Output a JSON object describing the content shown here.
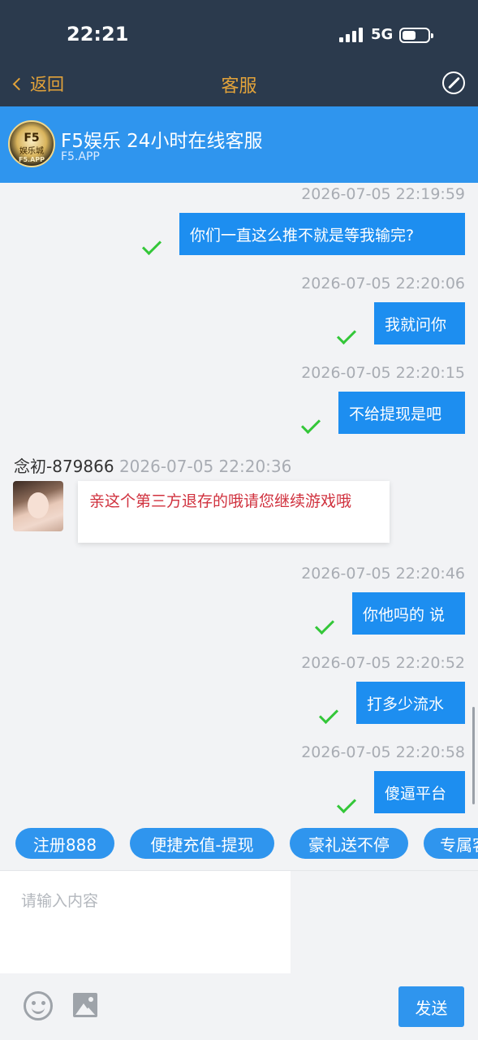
{
  "status_bar": {
    "time": "22:21",
    "network": "5G",
    "battery_icon": "battery-icon",
    "signal_icon": "signal-icon"
  },
  "nav": {
    "back_label": "返回",
    "title": "客服",
    "compass_icon": "compass-icon"
  },
  "service": {
    "name": "F5娱乐 24小时在线客服",
    "subtitle": "F5.APP",
    "logo": {
      "line1": "F5",
      "line2": "娱乐城",
      "line3": "F5.APP"
    }
  },
  "messages": [
    {
      "from": "me",
      "time": "2026-07-05 22:19:59",
      "text": "你们一直这么推不就是等我输完?"
    },
    {
      "from": "me",
      "time": "2026-07-05 22:20:06",
      "text": "我就问你"
    },
    {
      "from": "me",
      "time": "2026-07-05 22:20:15",
      "text": "不给提现是吧"
    },
    {
      "from": "agent",
      "sender": "念初-879866",
      "time": "2026-07-05 22:20:36",
      "text": "亲这个第三方退存的哦请您继续游戏哦"
    },
    {
      "from": "me",
      "time": "2026-07-05 22:20:46",
      "text": "你他吗的 说"
    },
    {
      "from": "me",
      "time": "2026-07-05 22:20:52",
      "text": "打多少流水"
    },
    {
      "from": "me",
      "time": "2026-07-05 22:20:58",
      "text": "傻逼平台"
    }
  ],
  "quick_replies": [
    "注册888",
    "便捷充值-提现",
    "豪礼送不停",
    "专属客"
  ],
  "composer": {
    "placeholder": "请输入内容",
    "value": "",
    "send_label": "发送"
  },
  "colors": {
    "topbar": "#2b3a4d",
    "accent_orange": "#e3a33a",
    "blue": "#2f95ee",
    "bubble_blue": "#1d8ef0",
    "check_green": "#34c739",
    "agent_text_red": "#d0313e"
  }
}
